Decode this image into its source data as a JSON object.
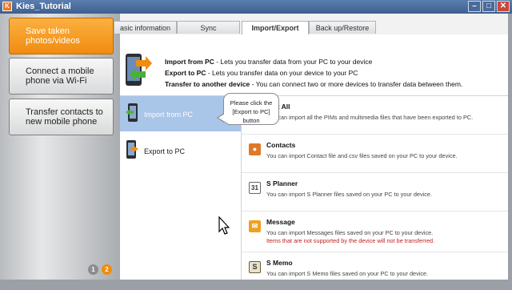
{
  "window": {
    "title": "Kies_Tutorial",
    "app_icon": "K"
  },
  "sidebar": {
    "items": [
      {
        "label": "Save taken photos/videos",
        "active": true
      },
      {
        "label": "Connect a mobile phone via Wi-Fi",
        "active": false
      },
      {
        "label": "Transfer contacts to new mobile phone",
        "active": false
      }
    ],
    "pages": [
      "1",
      "2"
    ],
    "current_page": "2"
  },
  "tabs": [
    "asic information",
    "Sync",
    "Import/Export",
    "Back up/Restore"
  ],
  "active_tab": "Import/Export",
  "header": {
    "lines": [
      {
        "bold": "Import from PC",
        "text": " - Lets you transfer data from your PC to your device"
      },
      {
        "bold": "Export to PC",
        "text": " - Lets you transfer data on your device to your PC"
      },
      {
        "bold": "Transfer to another device",
        "text": " - You can connect two or more devices to transfer data between them."
      }
    ]
  },
  "left_list": [
    {
      "label": "Import from PC",
      "selected": true
    },
    {
      "label": "Export to PC",
      "selected": false
    }
  ],
  "tooltip": {
    "line1": "Please click the",
    "line2": "[Export to PC] button"
  },
  "right_list": [
    {
      "title": "port All",
      "desc": "You can import all the PIMs and multimedia files that have been exported to PC.",
      "icon": "import-all-icon",
      "color": "#ffffff"
    },
    {
      "title": "Contacts",
      "desc": "You can import Contact file and csv files saved on your PC to your device.",
      "icon": "contacts-icon",
      "color": "#e0782a"
    },
    {
      "title": "S Planner",
      "desc": "You can import S Planner files saved on your PC to your device.",
      "icon": "calendar-icon",
      "color": "#4a7a3a",
      "glyph": "31"
    },
    {
      "title": "Message",
      "desc": "You can import Messages files saved on your PC to your device.",
      "warn": "Items that are not supported by the device will not be transferred.",
      "icon": "message-icon",
      "color": "#f0a020"
    },
    {
      "title": "S Memo",
      "desc": "You can import S Memo files saved on your PC to your device.",
      "icon": "memo-icon",
      "color": "#6b5a3a",
      "glyph": "S"
    }
  ]
}
